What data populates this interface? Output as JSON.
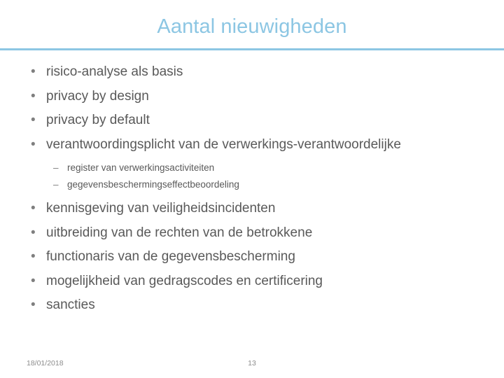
{
  "slide": {
    "title": "Aantal nieuwigheden",
    "accent_color": "#8CC6E3",
    "body_text_color": "#595959",
    "background_color": "#FFFFFF",
    "bullet_marker": "•",
    "sub_bullet_marker": "–",
    "bullets": [
      {
        "level": 1,
        "text": "risico-analyse als basis"
      },
      {
        "level": 1,
        "text": "privacy by design"
      },
      {
        "level": 1,
        "text": "privacy by default"
      },
      {
        "level": 1,
        "text": "verantwoordingsplicht van de verwerkings-verantwoordelijke"
      },
      {
        "level": 2,
        "text": "register van verwerkingsactiviteiten"
      },
      {
        "level": 2,
        "text": "gegevensbeschermingseffectbeoordeling"
      },
      {
        "level": 1,
        "text": "kennisgeving van veiligheidsincidenten"
      },
      {
        "level": 1,
        "text": "uitbreiding van de rechten van de betrokkene"
      },
      {
        "level": 1,
        "text": "functionaris van de gegevensbescherming"
      },
      {
        "level": 1,
        "text": "mogelijkheid van gedragscodes en certificering"
      },
      {
        "level": 1,
        "text": "sancties"
      }
    ],
    "footer": {
      "date": "18/01/2018",
      "page_number": "13"
    }
  }
}
